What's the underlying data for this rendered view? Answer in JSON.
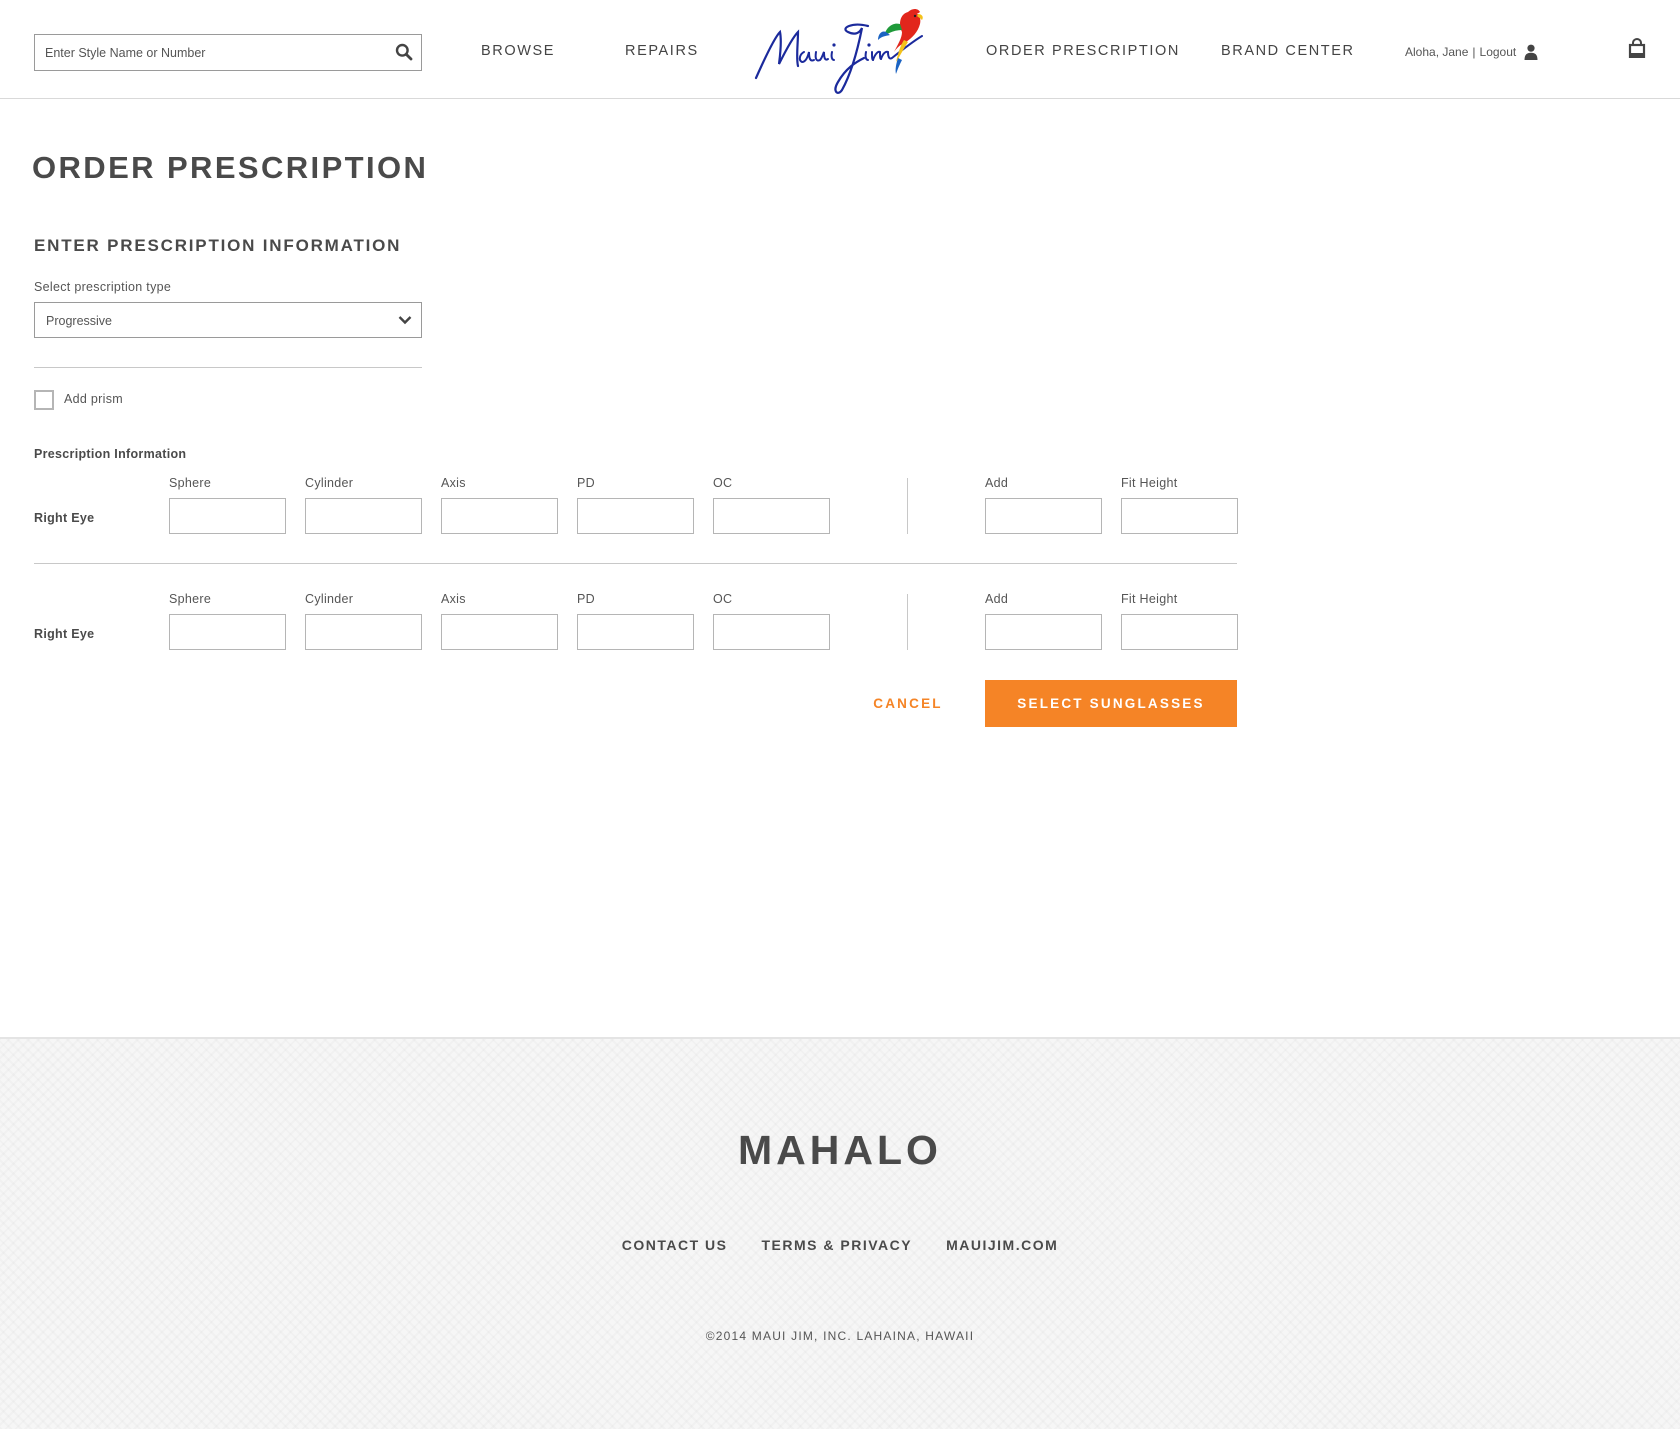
{
  "header": {
    "search": {
      "placeholder": "Enter Style Name or Number",
      "value": ""
    },
    "nav": {
      "browse": "BROWSE",
      "repairs": "REPAIRS",
      "order_prescription": "ORDER PRESCRIPTION",
      "brand_center": "BRAND CENTER"
    },
    "logo_alt": "Maui Jim",
    "user": {
      "greeting": "Aloha, Jane",
      "separator": "|",
      "logout": "Logout"
    }
  },
  "main": {
    "page_title": "ORDER PRESCRIPTION",
    "section_title": "ENTER PRESCRIPTION INFORMATION",
    "prescription_type": {
      "label": "Select prescription type",
      "selected": "Progressive"
    },
    "add_prism": {
      "label": "Add prism",
      "checked": false
    },
    "rx_info_label": "Prescription Information",
    "columns": {
      "sphere": "Sphere",
      "cylinder": "Cylinder",
      "axis": "Axis",
      "pd": "PD",
      "oc": "OC",
      "add": "Add",
      "fit_height": "Fit Height"
    },
    "rows": [
      {
        "eye": "Right Eye"
      },
      {
        "eye": "Right Eye"
      }
    ],
    "cancel_label": "CANCEL",
    "submit_label": "SELECT SUNGLASSES"
  },
  "footer": {
    "title": "MAHALO",
    "links": [
      "CONTACT US",
      "TERMS & PRIVACY",
      "MAUIJIM.COM"
    ],
    "copyright": "©2014 MAUI JIM, INC. LAHAINA, HAWAII"
  },
  "colors": {
    "accent": "#f58426",
    "text": "#4a4a4a",
    "logo_blue": "#1b2a9c"
  }
}
